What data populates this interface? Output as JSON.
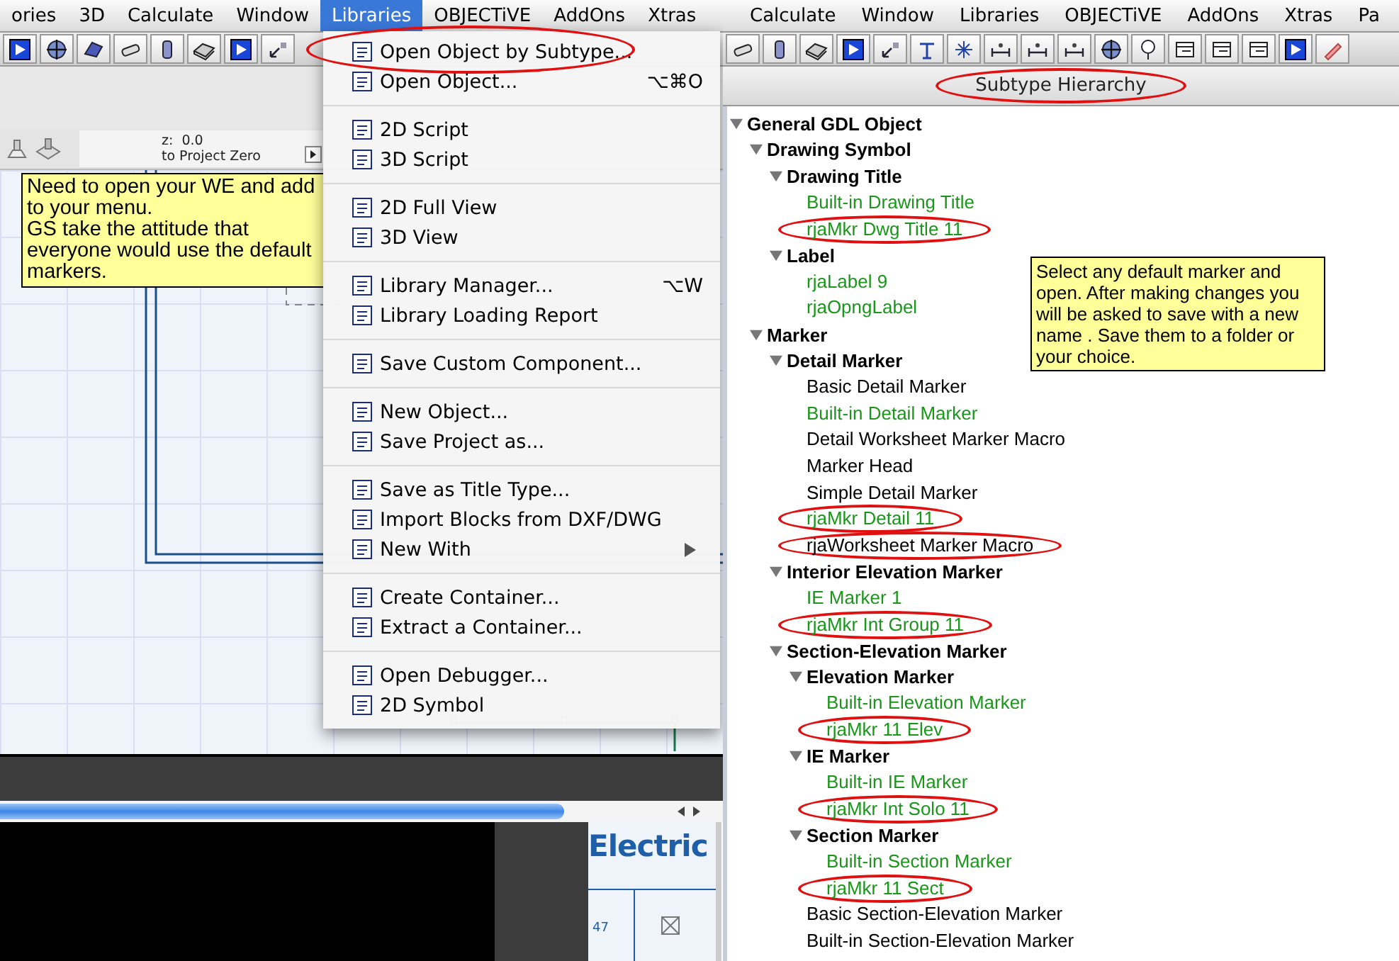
{
  "left_window": {
    "menubar": [
      {
        "label": "ories",
        "selected": false
      },
      {
        "label": "3D",
        "selected": false
      },
      {
        "label": "Calculate",
        "selected": false
      },
      {
        "label": "Window",
        "selected": false
      },
      {
        "label": "Libraries",
        "selected": true
      },
      {
        "label": "OBJECTiVE",
        "selected": false
      },
      {
        "label": "AddOns",
        "selected": false
      },
      {
        "label": "Xtras",
        "selected": false
      }
    ],
    "elevation_info": {
      "z_label": "z:",
      "z_value": "0.0",
      "reference": "to Project Zero"
    },
    "note": "Need to open your WE and add to your menu.\nGS take the attitude that everyone would use the default markers.",
    "drawing_preview": {
      "title": "Electric",
      "cell": "47"
    }
  },
  "libraries_menu": {
    "sections": [
      [
        {
          "label": "Open Object by Subtype...",
          "submenu": false,
          "circled": true
        },
        {
          "label": "Open Object...",
          "shortcut": "⌥⌘O",
          "submenu": false,
          "circled": false
        }
      ],
      [
        {
          "label": "2D Script",
          "submenu": false,
          "circled": false
        },
        {
          "label": "3D Script",
          "submenu": false,
          "circled": false
        }
      ],
      [
        {
          "label": "2D Full View",
          "submenu": false,
          "circled": false
        },
        {
          "label": "3D View",
          "submenu": false,
          "circled": false
        }
      ],
      [
        {
          "label": "Library Manager...",
          "shortcut": "⌥W",
          "submenu": false,
          "circled": false
        },
        {
          "label": "Library Loading Report",
          "submenu": false,
          "circled": false
        }
      ],
      [
        {
          "label": "Save Custom Component...",
          "submenu": false,
          "circled": false
        }
      ],
      [
        {
          "label": "New Object...",
          "submenu": false,
          "circled": false
        },
        {
          "label": "Save Project as...",
          "submenu": false,
          "circled": false
        }
      ],
      [
        {
          "label": "Save as Title Type...",
          "submenu": false,
          "circled": false
        },
        {
          "label": "Import Blocks from DXF/DWG",
          "submenu": false,
          "circled": false
        },
        {
          "label": "New With",
          "submenu": true,
          "circled": false
        }
      ],
      [
        {
          "label": "Create Container...",
          "submenu": false,
          "circled": false
        },
        {
          "label": "Extract a Container...",
          "submenu": false,
          "circled": false
        }
      ],
      [
        {
          "label": "Open Debugger...",
          "submenu": false,
          "circled": false
        },
        {
          "label": "2D Symbol",
          "submenu": false,
          "circled": false
        }
      ]
    ]
  },
  "right_window": {
    "menubar": [
      {
        "label": "Calculate",
        "selected": false
      },
      {
        "label": "Window",
        "selected": false
      },
      {
        "label": "Libraries",
        "selected": false
      },
      {
        "label": "OBJECTiVE",
        "selected": false
      },
      {
        "label": "AddOns",
        "selected": false
      },
      {
        "label": "Xtras",
        "selected": false
      },
      {
        "label": "Pa",
        "selected": false
      }
    ],
    "panel_title": {
      "label": "Subtype Hierarchy",
      "circled": true
    },
    "tree": [
      {
        "label": "General GDL Object",
        "expanded": true,
        "children": [
          {
            "label": "Drawing Symbol",
            "expanded": true,
            "children": [
              {
                "label": "Drawing Title",
                "expanded": true,
                "children": [
                  {
                    "label": "Built-in Drawing Title",
                    "color": "#1a961a",
                    "circled": false
                  },
                  {
                    "label": "rjaMkr Dwg Title 11",
                    "color": "#1a961a",
                    "circled": true
                  }
                ]
              },
              {
                "label": "Label",
                "expanded": true,
                "children": [
                  {
                    "label": "rjaLabel 9",
                    "color": "#1a961a",
                    "circled": false
                  },
                  {
                    "label": "rjaOpngLabel",
                    "color": "#1a961a",
                    "circled": false
                  }
                ]
              }
            ]
          },
          {
            "label": "Marker",
            "expanded": true,
            "children": [
              {
                "label": "Detail Marker",
                "expanded": true,
                "children": [
                  {
                    "label": "Basic Detail Marker",
                    "color": "#000000",
                    "circled": false
                  },
                  {
                    "label": "Built-in Detail Marker",
                    "color": "#1a961a",
                    "circled": false
                  },
                  {
                    "label": "Detail Worksheet Marker Macro",
                    "color": "#000000",
                    "circled": false
                  },
                  {
                    "label": "Marker Head",
                    "color": "#000000",
                    "circled": false
                  },
                  {
                    "label": "Simple Detail Marker",
                    "color": "#000000",
                    "circled": false
                  },
                  {
                    "label": "rjaMkr Detail 11",
                    "color": "#1a961a",
                    "circled": true
                  },
                  {
                    "label": "rjaWorksheet Marker Macro",
                    "color": "#000000",
                    "circled": true
                  }
                ]
              },
              {
                "label": "Interior Elevation Marker",
                "expanded": true,
                "children": [
                  {
                    "label": "IE Marker 1",
                    "color": "#1a961a",
                    "circled": false
                  },
                  {
                    "label": "rjaMkr Int Group  11",
                    "color": "#1a961a",
                    "circled": true
                  }
                ]
              },
              {
                "label": "Section-Elevation Marker",
                "expanded": true,
                "children": [
                  {
                    "label": "Elevation Marker",
                    "expanded": true,
                    "children": [
                      {
                        "label": "Built-in Elevation Marker",
                        "color": "#1a961a",
                        "circled": false
                      },
                      {
                        "label": "rjaMkr 11 Elev",
                        "color": "#1a961a",
                        "circled": true
                      }
                    ]
                  },
                  {
                    "label": "IE Marker",
                    "expanded": true,
                    "children": [
                      {
                        "label": "Built-in IE Marker",
                        "color": "#1a961a",
                        "circled": false
                      },
                      {
                        "label": "rjaMkr Int Solo  11",
                        "color": "#1a961a",
                        "circled": true
                      }
                    ]
                  },
                  {
                    "label": "Section Marker",
                    "expanded": true,
                    "children": [
                      {
                        "label": "Built-in Section Marker",
                        "color": "#1a961a",
                        "circled": false
                      },
                      {
                        "label": "rjaMkr 11 Sect",
                        "color": "#1a961a",
                        "circled": true
                      }
                    ]
                  },
                  {
                    "label": "Basic Section-Elevation Marker",
                    "color": "#000000",
                    "circled": false
                  },
                  {
                    "label": "Built-in Section-Elevation Marker",
                    "color": "#000000",
                    "circled": false
                  }
                ]
              }
            ]
          }
        ]
      }
    ],
    "note": "Select any default marker and open. After making changes you will be asked to save with a new name . Save them to a folder or your choice."
  }
}
